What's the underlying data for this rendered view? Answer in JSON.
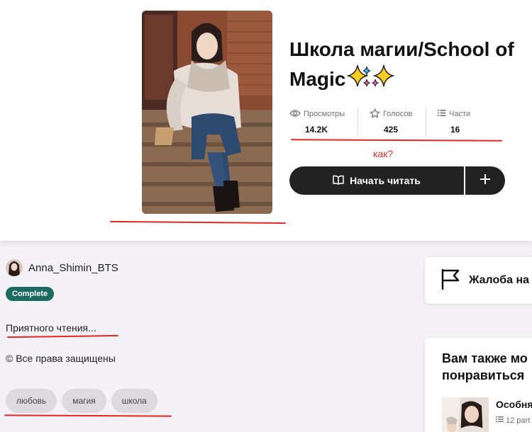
{
  "story": {
    "title_line1": "Школа магии/School of",
    "title_line2": "Magic"
  },
  "stats": [
    {
      "label": "Просмотры",
      "value": "14.2K",
      "icon": "eye-icon"
    },
    {
      "label": "Голосов",
      "value": "425",
      "icon": "star-icon"
    },
    {
      "label": "Части",
      "value": "16",
      "icon": "list-icon"
    }
  ],
  "annotation": {
    "note": "как?",
    "color": "#e8251d"
  },
  "actions": {
    "read_label": "Начать читать"
  },
  "author": {
    "name": "Anna_Shimin_BTS"
  },
  "badge": {
    "label": "Complete",
    "color": "#1b6b62"
  },
  "description": "Приятного чтения...",
  "copyright": "© Все права защищены",
  "tags": [
    "любовь",
    "магия",
    "школа"
  ],
  "report": {
    "label": "Жалоба на"
  },
  "suggestions": {
    "title_line1": "Вам также мо",
    "title_line2": "понравиться",
    "item_title": "Особня",
    "item_parts": "12 part"
  }
}
